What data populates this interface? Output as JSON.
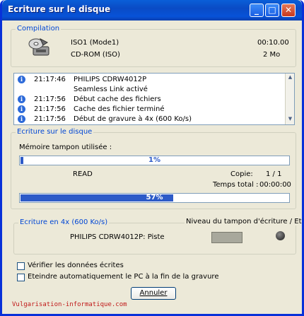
{
  "window": {
    "title": "Ecriture sur le disque",
    "minimize": "_",
    "maximize": "□",
    "close": "✕"
  },
  "compilation": {
    "legend": "Compilation",
    "icon": "disc-burn-icon",
    "name": "ISO1 (Mode1)",
    "type": "CD-ROM (ISO)",
    "duration": "00:10.00",
    "size": "2 Mo"
  },
  "log": [
    {
      "time": "21:17:46",
      "message": "PHILIPS CDRW4012P",
      "icon": "info-icon"
    },
    {
      "time": "",
      "message": "Seamless Link activé",
      "icon": ""
    },
    {
      "time": "21:17:56",
      "message": "Début cache des fichiers",
      "icon": "info-icon"
    },
    {
      "time": "21:17:56",
      "message": "Cache des fichier terminé",
      "icon": "info-icon"
    },
    {
      "time": "21:17:56",
      "message": "Début de gravure à 4x (600 Ko/s)",
      "icon": "info-icon"
    }
  ],
  "writing": {
    "legend": "Ecriture sur le disque",
    "buffer_label": "Mémoire tampon utilisée :",
    "buffer_percent_text": "1%",
    "buffer_fraction": 0.01,
    "status": "READ",
    "copy_label": "Copie:",
    "copy_value": "1 / 1",
    "total_time_label": "Temps total :",
    "total_time_value": "00:00:00",
    "progress_text": "57%",
    "progress_fraction": 0.57
  },
  "speed": {
    "legend": "Ecriture en 4x (600 Ko/s)",
    "buffer_state_label": "Niveau du tampon d'écriture / Etat",
    "drive_label": "PHILIPS CDRW4012P: Piste"
  },
  "options": {
    "verify_label": "Vérifier les données écrites",
    "shutdown_label": "Eteindre automatiquement le PC à la fin de la gravure",
    "verify_checked": false,
    "shutdown_checked": false
  },
  "actions": {
    "cancel_label": "Annuler"
  },
  "footer": {
    "watermark": "Vulgarisation-informatique.com"
  },
  "colors": {
    "accent": "#0046D5",
    "progress": "#2D5BC8",
    "watermark": "#C01818"
  }
}
